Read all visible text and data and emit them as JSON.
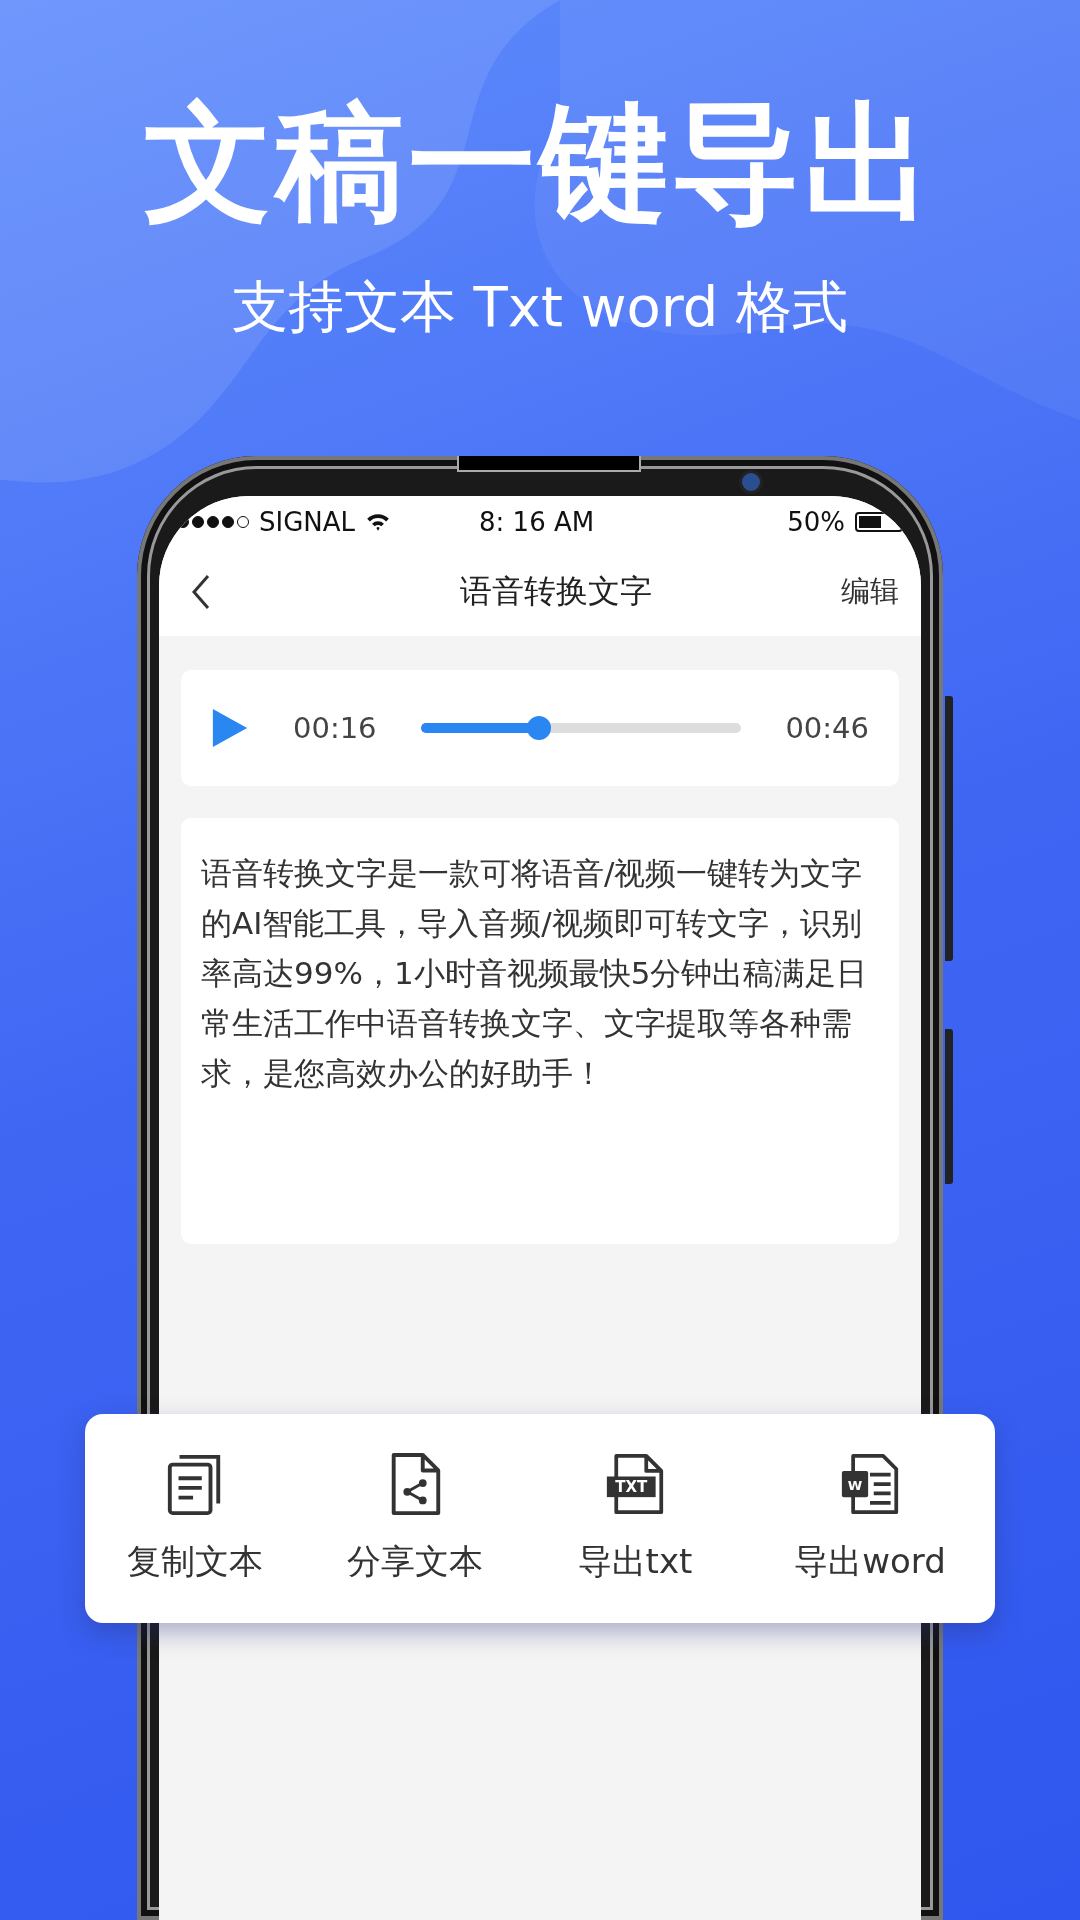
{
  "headline": "文稿一键导出",
  "subheadline": "支持文本 Txt word 格式",
  "status_bar": {
    "carrier": "SIGNAL",
    "time": "8: 16 AM",
    "battery_text": "50%"
  },
  "nav": {
    "title": "语音转换文字",
    "action": "编辑"
  },
  "player": {
    "current": "00:16",
    "total": "00:46",
    "level": 0.37,
    "playing": false
  },
  "transcript": "语音转换文字是一款可将语音/视频一键转为文字的AI智能工具，导入音频/视频即可转文字，识别率高达99%，1小时音视频最快5分钟出稿满足日常生活工作中语音转换文字、文字提取等各种需求，是您高效办公的好助手！",
  "actions": [
    {
      "kind": "copy",
      "label": "复制文本"
    },
    {
      "kind": "share",
      "label": "分享文本"
    },
    {
      "kind": "txt",
      "label": "导出txt",
      "icon_text": "TXT"
    },
    {
      "kind": "word",
      "label": "导出word",
      "icon_text": "W"
    }
  ]
}
